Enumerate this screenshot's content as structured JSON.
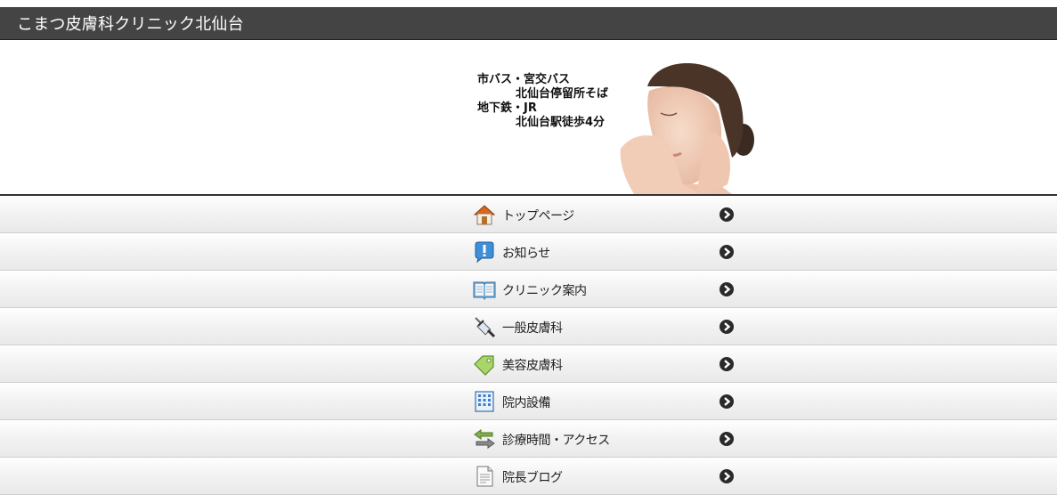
{
  "header": {
    "site_title": "こまつ皮膚科クリニック北仙台"
  },
  "banner": {
    "line1": "市バス・宮交バス",
    "line2": "北仙台停留所そば",
    "line3": "地下鉄・JR",
    "line4": "北仙台駅徒歩4分"
  },
  "menu": {
    "items": [
      {
        "label": "トップページ",
        "icon": "house-icon"
      },
      {
        "label": "お知らせ",
        "icon": "info-bubble-icon"
      },
      {
        "label": "クリニック案内",
        "icon": "open-book-icon"
      },
      {
        "label": "一般皮膚科",
        "icon": "syringe-icon"
      },
      {
        "label": "美容皮膚科",
        "icon": "tag-icon"
      },
      {
        "label": "院内設備",
        "icon": "building-icon"
      },
      {
        "label": "診療時間・アクセス",
        "icon": "arrows-icon"
      },
      {
        "label": "院長ブログ",
        "icon": "document-icon"
      }
    ]
  },
  "colors": {
    "title_bar": "#444444",
    "arrow": "#2a2a2a"
  }
}
